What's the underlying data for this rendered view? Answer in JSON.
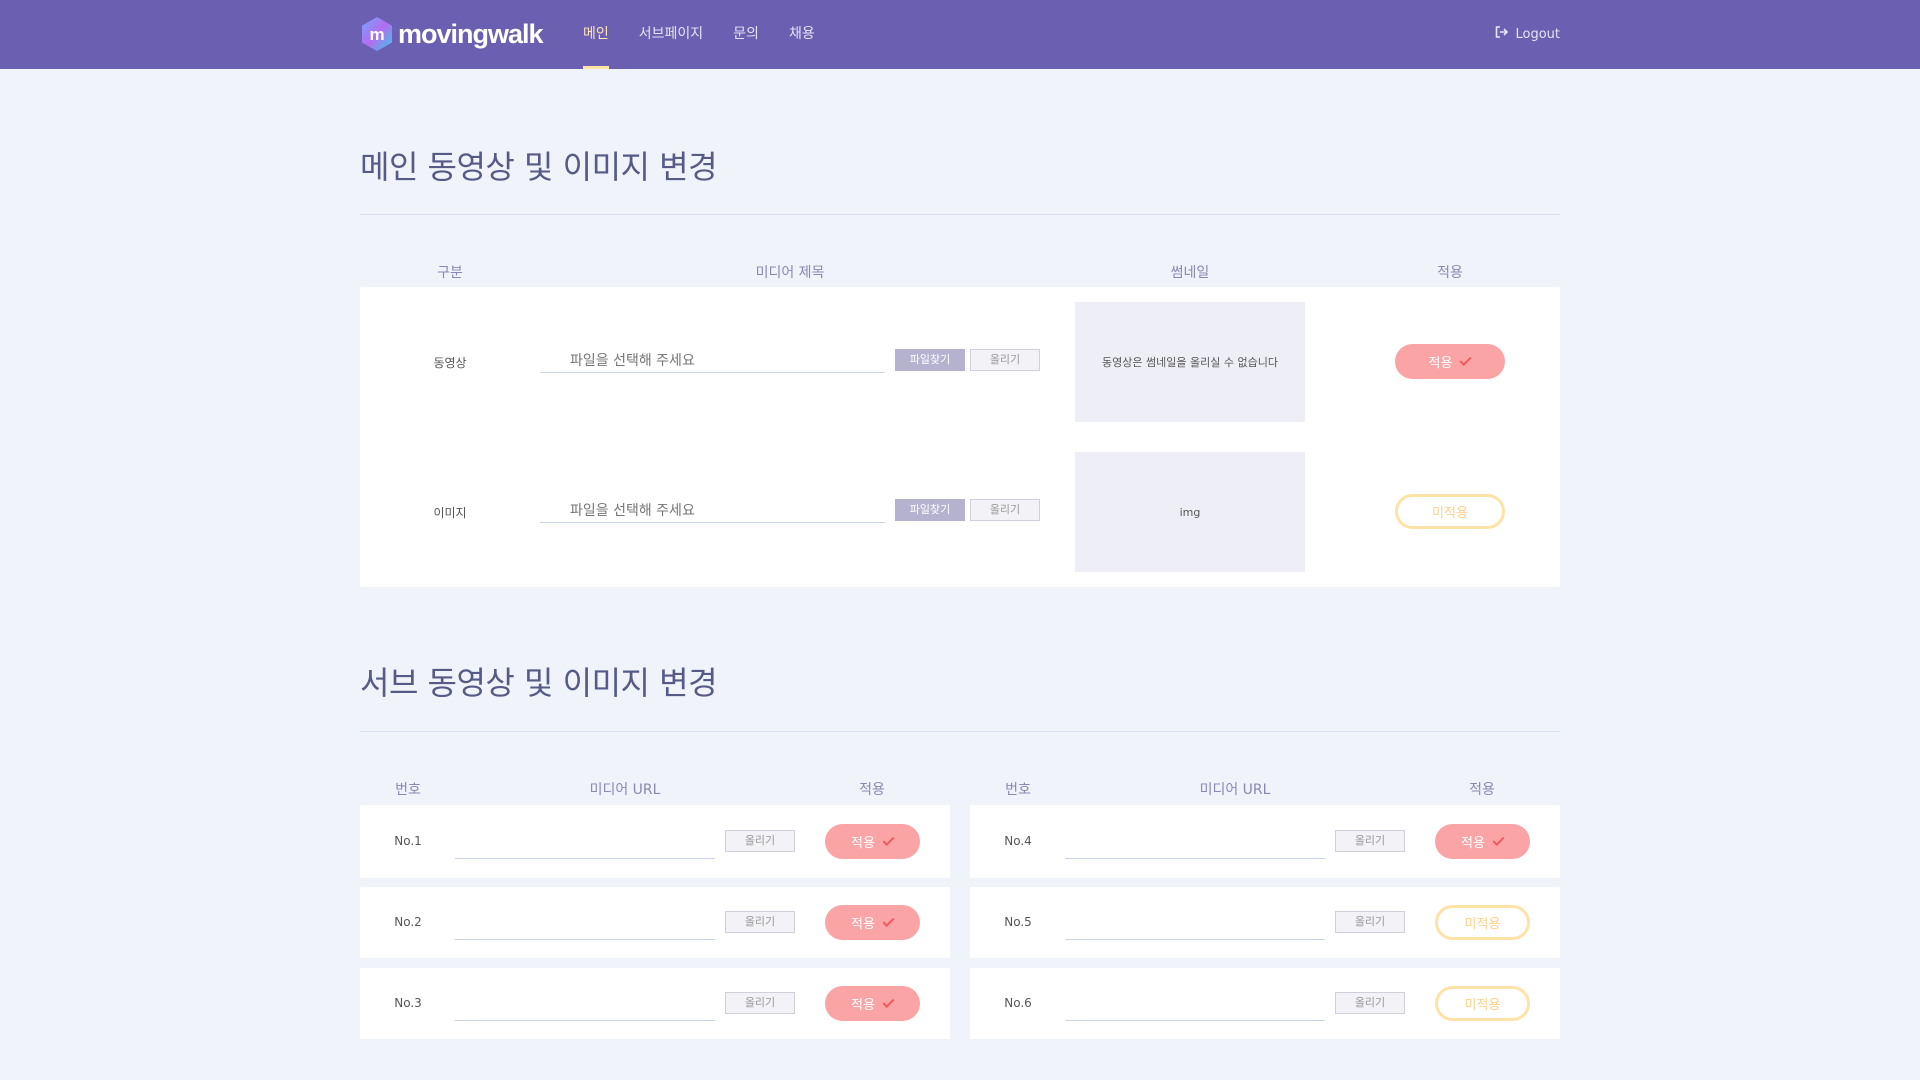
{
  "brand": {
    "name": "movingwalk",
    "mark": "m"
  },
  "nav": {
    "items": [
      {
        "label": "메인",
        "active": true
      },
      {
        "label": "서브페이지",
        "active": false
      },
      {
        "label": "문의",
        "active": false
      },
      {
        "label": "채용",
        "active": false
      }
    ],
    "logout_label": "Logout"
  },
  "main_section": {
    "title": "메인 동영상 및 이미지 변경",
    "headers": {
      "type": "구분",
      "title": "미디어 제목",
      "thumb": "썸네일",
      "apply": "적용"
    },
    "rows": [
      {
        "type": "동영상",
        "placeholder": "파일을 선택해 주세요",
        "find_label": "파일찾기",
        "upload_label": "올리기",
        "thumb_text": "동영상은 썸네일을 올리실 수 없습니다",
        "status": "적용",
        "applied": true
      },
      {
        "type": "이미지",
        "placeholder": "파일을 선택해 주세요",
        "find_label": "파일찾기",
        "upload_label": "올리기",
        "thumb_text": "img",
        "status": "미적용",
        "applied": false
      }
    ]
  },
  "sub_section": {
    "title": "서브 동영상 및 이미지 변경",
    "headers": {
      "no": "번호",
      "url": "미디어 URL",
      "apply": "적용"
    },
    "left_rows": [
      {
        "no": "No.1",
        "upload_label": "올리기",
        "status": "적용",
        "applied": true
      },
      {
        "no": "No.2",
        "upload_label": "올리기",
        "status": "적용",
        "applied": true
      },
      {
        "no": "No.3",
        "upload_label": "올리기",
        "status": "적용",
        "applied": true
      }
    ],
    "right_rows": [
      {
        "no": "No.4",
        "upload_label": "올리기",
        "status": "적용",
        "applied": true
      },
      {
        "no": "No.5",
        "upload_label": "올리기",
        "status": "미적용",
        "applied": false
      },
      {
        "no": "No.6",
        "upload_label": "올리기",
        "status": "미적용",
        "applied": false
      }
    ]
  },
  "colors": {
    "header_bg": "#6a5fb0",
    "accent": "#ffe4a8",
    "applied_pill": "#fba4a5",
    "unapplied_border": "#ffe2a5"
  }
}
